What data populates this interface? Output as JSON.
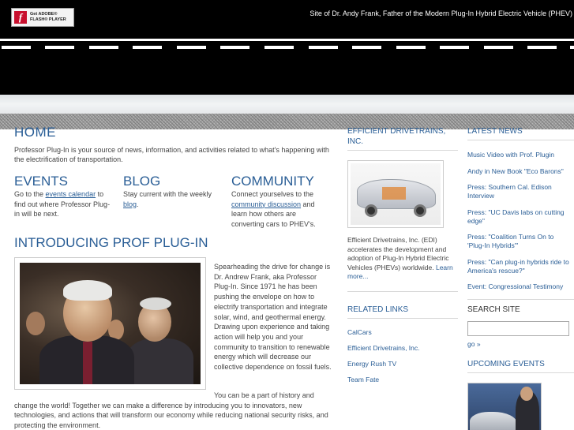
{
  "header": {
    "flash_line1": "Get ADOBE®",
    "flash_line2": "FLASH® PLAYER",
    "tagline": "Site of Dr. Andy Frank, Father of the Modern Plug-In Hybrid Electric Vehicle (PHEV)"
  },
  "main": {
    "home_title": "HOME",
    "intro": "Professor Plug-In is your source of news, information, and activities related to what's happening with the electrification of transportation.",
    "events": {
      "title": "EVENTS",
      "text_before": "Go to the ",
      "link": "events calendar",
      "text_after": " to find out where Professor Plug-in will be next."
    },
    "blog": {
      "title": "BLOG",
      "text_before": "Stay current with the weekly ",
      "link": "blog",
      "text_after": "."
    },
    "community": {
      "title": "COMMUNITY",
      "text_before": "Connect yourselves to the ",
      "link": "community discussion",
      "text_after": " and learn how others are converting cars to PHEV's."
    },
    "prof_title": "INTRODUCING PROF PLUG-IN",
    "side_text": "Spearheading the drive for change is Dr. Andrew Frank, aka Professor Plug-In. Since 1971 he has been pushing the envelope on how to electrify transportation and integrate solar, wind, and geothermal energy. Drawing upon experience and taking action will help you and your community to transition to renewable energy which will decrease our collective dependence on fossil fuels.",
    "bottom_text": "You can be a part of history and change the world! Together we can make a difference by introducing you to innovators, new technologies, and actions that will transform our economy while reducing national security risks, and protecting the environment."
  },
  "mid": {
    "edi_title": "EFFICIENT DRIVETRAINS, INC.",
    "edi_text": "Efficient Drivetrains, Inc. (EDI) accelerates the development and adoption of Plug-In Hybrid Electric Vehicles (PHEVs) worldwide. ",
    "edi_more": "Learn more...",
    "related_title": "RELATED LINKS",
    "related_links": [
      "CalCars",
      "Efficient Drivetrains, Inc.",
      "Energy Rush TV",
      "Team Fate"
    ]
  },
  "right": {
    "news_title": "LATEST NEWS",
    "news": [
      "Music Video with Prof. Plugin",
      "Andy in New Book \"Eco Barons\"",
      "Press: Southern Cal. Edison Interview",
      "Press: \"UC Davis labs on cutting edge\"",
      "Press: \"Coalition Turns On to 'Plug-In Hybrids'\"",
      "Press: \"Can plug-in hybrids ride to America's rescue?\"",
      "Event: Congressional Testimony"
    ],
    "search_title": "SEARCH SITE",
    "search_placeholder": "",
    "go_label": "go »",
    "events_title": "UPCOMING EVENTS"
  },
  "colors": {
    "accent": "#2a5e96",
    "header_bg": "#000000"
  }
}
